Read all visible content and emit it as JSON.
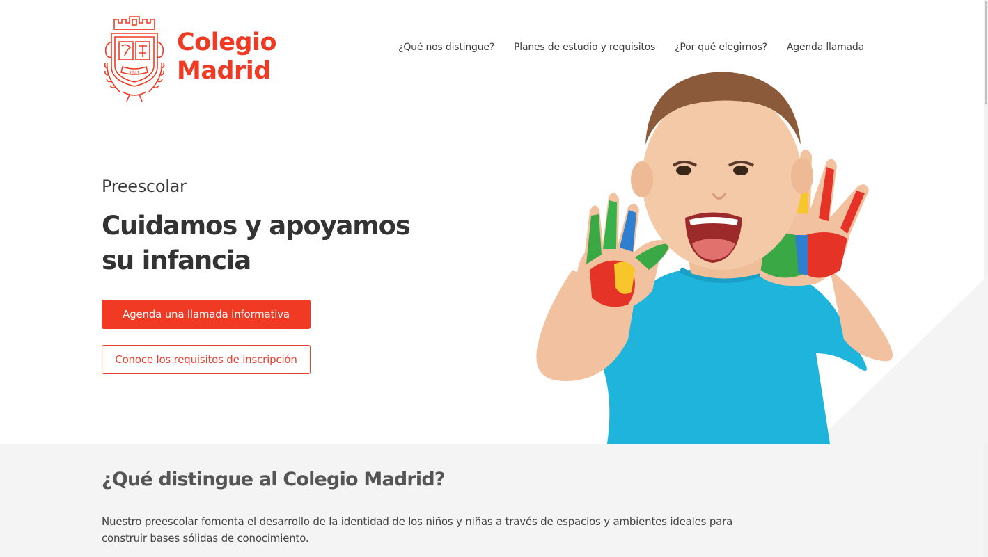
{
  "brand": {
    "name_line1": "Colegio",
    "name_line2": "Madrid",
    "crest_year": "1941",
    "accent_color": "#f03a24"
  },
  "nav": {
    "items": [
      {
        "label": "¿Qué nos distingue?"
      },
      {
        "label": "Planes de estudio y requisitos"
      },
      {
        "label": "¿Por qué elegirnos?"
      },
      {
        "label": "Agenda llamada"
      }
    ]
  },
  "hero": {
    "eyebrow": "Preescolar",
    "title": "Cuidamos y apoyamos su infancia",
    "primary_button": "Agenda una llamada informativa",
    "secondary_button": "Conoce los requisitos de inscripción",
    "image_subject": "child-with-painted-hands"
  },
  "section": {
    "heading": "¿Qué distingue al Colegio Madrid?",
    "body": "Nuestro preescolar fomenta el desarrollo de la identidad de los niños y niñas a través de espacios y ambientes ideales para construir bases sólidas de conocimiento."
  }
}
